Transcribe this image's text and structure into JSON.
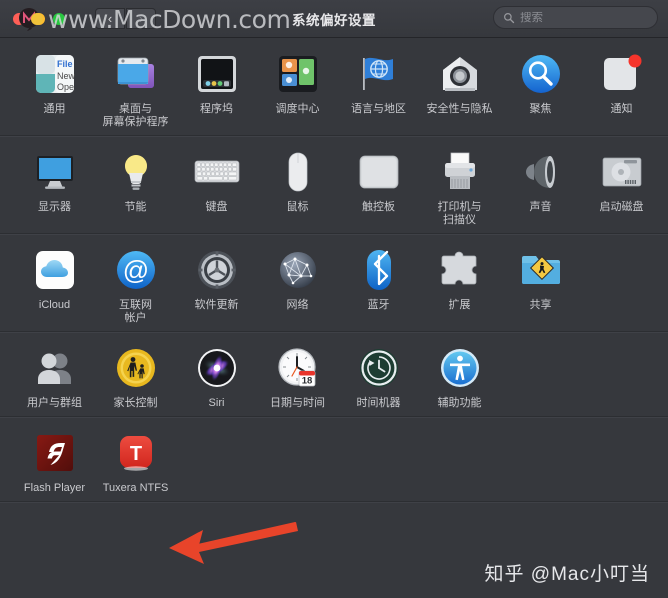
{
  "window": {
    "title": "系统偏好设置",
    "back_label": "‹",
    "forward_label": "›",
    "traffic": {
      "close": "close",
      "minimize": "minimize",
      "zoom": "zoom"
    }
  },
  "search": {
    "placeholder": "搜索",
    "value": "",
    "icon": "search-icon"
  },
  "rows": [
    {
      "name": "row-personal",
      "items": [
        {
          "id": "general",
          "label": "通用",
          "icon": "general-icon"
        },
        {
          "id": "desktop",
          "label": "桌面与\n屏幕保护程序",
          "icon": "desktop-screensaver-icon"
        },
        {
          "id": "dock",
          "label": "程序坞",
          "icon": "dock-icon"
        },
        {
          "id": "mission",
          "label": "调度中心",
          "icon": "mission-control-icon"
        },
        {
          "id": "language",
          "label": "语言与地区",
          "icon": "language-region-icon"
        },
        {
          "id": "security",
          "label": "安全性与隐私",
          "icon": "security-privacy-icon"
        },
        {
          "id": "spotlight",
          "label": "聚焦",
          "icon": "spotlight-icon"
        },
        {
          "id": "notification",
          "label": "通知",
          "icon": "notifications-icon"
        }
      ]
    },
    {
      "name": "row-hardware",
      "items": [
        {
          "id": "displays",
          "label": "显示器",
          "icon": "displays-icon"
        },
        {
          "id": "energy",
          "label": "节能",
          "icon": "energy-saver-icon"
        },
        {
          "id": "keyboard",
          "label": "键盘",
          "icon": "keyboard-icon"
        },
        {
          "id": "mouse",
          "label": "鼠标",
          "icon": "mouse-icon"
        },
        {
          "id": "trackpad",
          "label": "触控板",
          "icon": "trackpad-icon"
        },
        {
          "id": "printers",
          "label": "打印机与\n扫描仪",
          "icon": "printers-scanners-icon"
        },
        {
          "id": "sound",
          "label": "声音",
          "icon": "sound-icon"
        },
        {
          "id": "startup",
          "label": "启动磁盘",
          "icon": "startup-disk-icon"
        }
      ]
    },
    {
      "name": "row-internet",
      "items": [
        {
          "id": "icloud",
          "label": "iCloud",
          "icon": "icloud-icon"
        },
        {
          "id": "accounts",
          "label": "互联网\n帐户",
          "icon": "internet-accounts-icon"
        },
        {
          "id": "update",
          "label": "软件更新",
          "icon": "software-update-icon"
        },
        {
          "id": "network",
          "label": "网络",
          "icon": "network-icon"
        },
        {
          "id": "bluetooth",
          "label": "蓝牙",
          "icon": "bluetooth-icon"
        },
        {
          "id": "extensions",
          "label": "扩展",
          "icon": "extensions-icon"
        },
        {
          "id": "sharing",
          "label": "共享",
          "icon": "sharing-icon"
        }
      ]
    },
    {
      "name": "row-system",
      "items": [
        {
          "id": "users",
          "label": "用户与群组",
          "icon": "users-groups-icon"
        },
        {
          "id": "parental",
          "label": "家长控制",
          "icon": "parental-controls-icon"
        },
        {
          "id": "siri",
          "label": "Siri",
          "icon": "siri-icon"
        },
        {
          "id": "datetime",
          "label": "日期与时间",
          "icon": "date-time-icon"
        },
        {
          "id": "timemachine",
          "label": "时间机器",
          "icon": "time-machine-icon"
        },
        {
          "id": "accessibility",
          "label": "辅助功能",
          "icon": "accessibility-icon"
        }
      ]
    },
    {
      "name": "row-third-party",
      "items": [
        {
          "id": "flash",
          "label": "Flash Player",
          "icon": "flash-player-icon"
        },
        {
          "id": "tuxera",
          "label": "Tuxera NTFS",
          "icon": "tuxera-ntfs-icon"
        }
      ]
    }
  ],
  "annotation": {
    "arrow": {
      "name": "red-arrow-pointing-to-tuxera",
      "color": "#e8442a",
      "direction": "left"
    }
  },
  "watermarks": {
    "top": "www.MacDown.com",
    "bottom": "知乎 @Mac小叮当"
  },
  "colors": {
    "window_bg": "#36383d",
    "toolbar_bg": "#3d3f45",
    "label_text": "#c9cace",
    "accent_red": "#e8442a",
    "badge_red": "#f6342b"
  }
}
